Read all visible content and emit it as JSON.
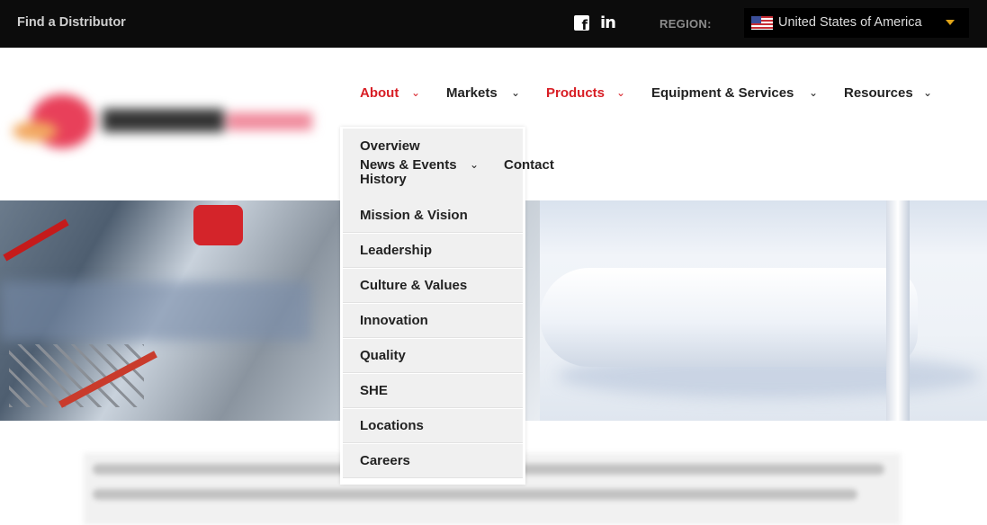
{
  "topbar": {
    "find_distributor": "Find a Distributor",
    "facebook_icon": "f",
    "linkedin_icon": "in",
    "region_label": "REGION:",
    "region_value": "United States of America"
  },
  "nav": {
    "items": [
      {
        "label": "About",
        "active": true
      },
      {
        "label": "Markets",
        "active": false
      },
      {
        "label": "Products",
        "active": true
      },
      {
        "label": "Equipment & Services",
        "active": false
      },
      {
        "label": "Resources",
        "active": false
      }
    ],
    "secondary": [
      {
        "label": "News & Events"
      },
      {
        "label": "Contact"
      }
    ],
    "chevron": "⌄"
  },
  "about_menu": {
    "items": [
      "Overview",
      "History",
      "Mission & Vision",
      "Leadership",
      "Culture & Values",
      "Innovation",
      "Quality",
      "SHE",
      "Locations",
      "Careers"
    ]
  },
  "colors": {
    "topbar_bg": "#0c0c0c",
    "accent_red": "#d81e25",
    "region_caret": "#e0a418",
    "dropdown_bg": "#f0f0f0"
  }
}
